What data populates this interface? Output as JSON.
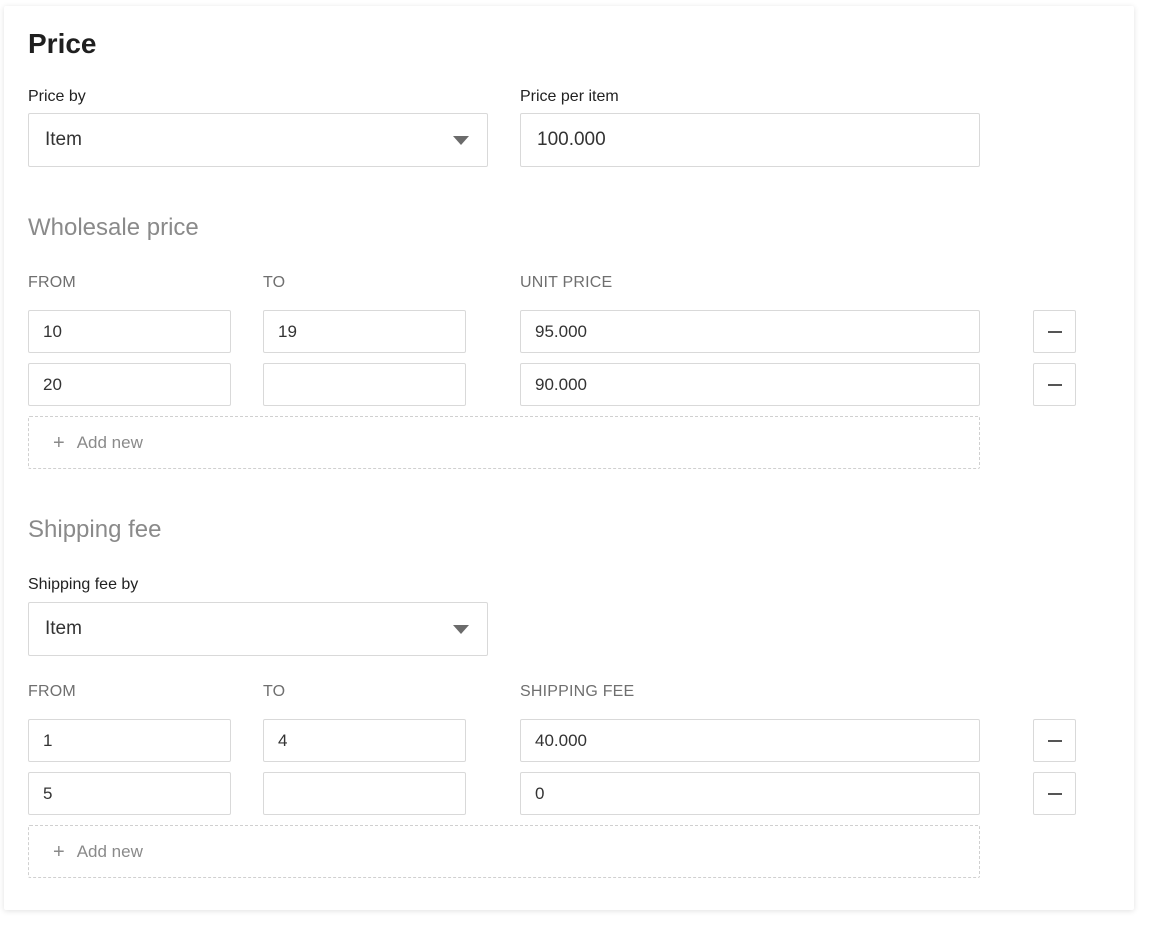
{
  "price": {
    "title": "Price",
    "price_by_label": "Price by",
    "price_by_value": "Item",
    "price_per_item_label": "Price per item",
    "price_per_item_value": "100.000"
  },
  "wholesale": {
    "title": "Wholesale price",
    "columns": {
      "from": "FROM",
      "to": "TO",
      "unit_price": "UNIT PRICE"
    },
    "rows": [
      {
        "from": "10",
        "to": "19",
        "unit_price": "95.000"
      },
      {
        "from": "20",
        "to": "",
        "unit_price": "90.000"
      }
    ],
    "add_new_label": "Add new"
  },
  "shipping": {
    "title": "Shipping fee",
    "fee_by_label": "Shipping fee by",
    "fee_by_value": "Item",
    "columns": {
      "from": "FROM",
      "to": "TO",
      "shipping_fee": "SHIPPING FEE"
    },
    "rows": [
      {
        "from": "1",
        "to": "4",
        "shipping_fee": "40.000"
      },
      {
        "from": "5",
        "to": "",
        "shipping_fee": "0"
      }
    ],
    "add_new_label": "Add new"
  }
}
